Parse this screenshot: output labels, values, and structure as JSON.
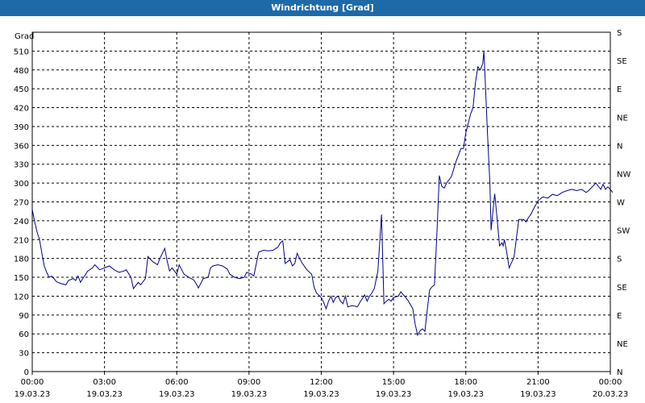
{
  "window": {
    "title": "Windrichtung [Grad]"
  },
  "chart_data": {
    "type": "line",
    "title": "Windrichtung [Grad]",
    "ylabel": "Grad",
    "xlabel": "",
    "ylim": [
      0,
      540
    ],
    "xlim_hours": [
      0,
      24
    ],
    "grid": true,
    "line_color": "#00008b",
    "y_ticks": [
      0,
      30,
      60,
      90,
      120,
      150,
      180,
      210,
      240,
      270,
      300,
      330,
      360,
      390,
      420,
      450,
      480,
      510
    ],
    "y_right_ticks": [
      {
        "value": 0,
        "label": "N"
      },
      {
        "value": 45,
        "label": "NE"
      },
      {
        "value": 90,
        "label": "E"
      },
      {
        "value": 135,
        "label": "SE"
      },
      {
        "value": 180,
        "label": "S"
      },
      {
        "value": 225,
        "label": "SW"
      },
      {
        "value": 270,
        "label": "W"
      },
      {
        "value": 315,
        "label": "NW"
      },
      {
        "value": 360,
        "label": "N"
      },
      {
        "value": 405,
        "label": "NE"
      },
      {
        "value": 450,
        "label": "E"
      },
      {
        "value": 495,
        "label": "SE"
      },
      {
        "value": 540,
        "label": "S"
      }
    ],
    "x_ticks": [
      {
        "hour": 0,
        "time": "00:00",
        "date": "19.03.23"
      },
      {
        "hour": 3,
        "time": "03:00",
        "date": "19.03.23"
      },
      {
        "hour": 6,
        "time": "06:00",
        "date": "19.03.23"
      },
      {
        "hour": 9,
        "time": "09:00",
        "date": "19.03.23"
      },
      {
        "hour": 12,
        "time": "12:00",
        "date": "19.03.23"
      },
      {
        "hour": 15,
        "time": "15:00",
        "date": "19.03.23"
      },
      {
        "hour": 18,
        "time": "18:00",
        "date": "19.03.23"
      },
      {
        "hour": 21,
        "time": "21:00",
        "date": "19.03.23"
      },
      {
        "hour": 24,
        "time": "00:00",
        "date": "20.03.23"
      }
    ],
    "series": [
      {
        "points": [
          [
            0.0,
            258
          ],
          [
            0.1,
            238
          ],
          [
            0.2,
            222
          ],
          [
            0.3,
            210
          ],
          [
            0.4,
            188
          ],
          [
            0.5,
            168
          ],
          [
            0.6,
            158
          ],
          [
            0.7,
            150
          ],
          [
            0.8,
            152
          ],
          [
            0.9,
            148
          ],
          [
            1.0,
            143
          ],
          [
            1.2,
            140
          ],
          [
            1.4,
            138
          ],
          [
            1.5,
            145
          ],
          [
            1.7,
            148
          ],
          [
            1.8,
            145
          ],
          [
            1.9,
            152
          ],
          [
            2.0,
            142
          ],
          [
            2.1,
            148
          ],
          [
            2.3,
            160
          ],
          [
            2.5,
            165
          ],
          [
            2.6,
            170
          ],
          [
            2.8,
            162
          ],
          [
            3.0,
            165
          ],
          [
            3.2,
            168
          ],
          [
            3.4,
            162
          ],
          [
            3.6,
            158
          ],
          [
            3.8,
            160
          ],
          [
            3.9,
            162
          ],
          [
            4.1,
            150
          ],
          [
            4.2,
            132
          ],
          [
            4.4,
            142
          ],
          [
            4.5,
            138
          ],
          [
            4.7,
            148
          ],
          [
            4.8,
            183
          ],
          [
            5.0,
            175
          ],
          [
            5.2,
            170
          ],
          [
            5.3,
            180
          ],
          [
            5.5,
            196
          ],
          [
            5.6,
            176
          ],
          [
            5.7,
            160
          ],
          [
            5.8,
            165
          ],
          [
            6.0,
            155
          ],
          [
            6.1,
            170
          ],
          [
            6.3,
            155
          ],
          [
            6.5,
            150
          ],
          [
            6.7,
            146
          ],
          [
            6.8,
            140
          ],
          [
            6.9,
            133
          ],
          [
            7.1,
            148
          ],
          [
            7.3,
            150
          ],
          [
            7.4,
            165
          ],
          [
            7.5,
            168
          ],
          [
            7.7,
            170
          ],
          [
            7.9,
            168
          ],
          [
            8.1,
            163
          ],
          [
            8.2,
            155
          ],
          [
            8.4,
            150
          ],
          [
            8.6,
            148
          ],
          [
            8.8,
            150
          ],
          [
            8.9,
            158
          ],
          [
            9.1,
            155
          ],
          [
            9.2,
            152
          ],
          [
            9.4,
            190
          ],
          [
            9.6,
            193
          ],
          [
            9.8,
            192
          ],
          [
            10.0,
            193
          ],
          [
            10.2,
            198
          ],
          [
            10.3,
            205
          ],
          [
            10.4,
            208
          ],
          [
            10.5,
            172
          ],
          [
            10.7,
            178
          ],
          [
            10.8,
            168
          ],
          [
            10.9,
            172
          ],
          [
            11.0,
            188
          ],
          [
            11.1,
            180
          ],
          [
            11.2,
            173
          ],
          [
            11.4,
            162
          ],
          [
            11.6,
            155
          ],
          [
            11.7,
            135
          ],
          [
            11.8,
            125
          ],
          [
            12.0,
            118
          ],
          [
            12.1,
            110
          ],
          [
            12.2,
            100
          ],
          [
            12.3,
            112
          ],
          [
            12.4,
            120
          ],
          [
            12.5,
            110
          ],
          [
            12.6,
            118
          ],
          [
            12.7,
            120
          ],
          [
            12.8,
            112
          ],
          [
            12.9,
            108
          ],
          [
            13.0,
            120
          ],
          [
            13.1,
            103
          ],
          [
            13.3,
            105
          ],
          [
            13.5,
            103
          ],
          [
            13.6,
            110
          ],
          [
            13.8,
            122
          ],
          [
            13.9,
            112
          ],
          [
            14.0,
            120
          ],
          [
            14.1,
            125
          ],
          [
            14.2,
            132
          ],
          [
            14.35,
            160
          ],
          [
            14.5,
            250
          ],
          [
            14.6,
            108
          ],
          [
            14.7,
            112
          ],
          [
            14.8,
            115
          ],
          [
            14.9,
            112
          ],
          [
            15.0,
            118
          ],
          [
            15.2,
            120
          ],
          [
            15.3,
            127
          ],
          [
            15.5,
            118
          ],
          [
            15.6,
            113
          ],
          [
            15.8,
            100
          ],
          [
            15.9,
            75
          ],
          [
            16.0,
            58
          ],
          [
            16.1,
            65
          ],
          [
            16.2,
            68
          ],
          [
            16.3,
            64
          ],
          [
            16.4,
            98
          ],
          [
            16.5,
            130
          ],
          [
            16.6,
            135
          ],
          [
            16.7,
            138
          ],
          [
            16.8,
            220
          ],
          [
            16.9,
            312
          ],
          [
            17.0,
            295
          ],
          [
            17.1,
            292
          ],
          [
            17.2,
            300
          ],
          [
            17.4,
            310
          ],
          [
            17.6,
            335
          ],
          [
            17.8,
            355
          ],
          [
            17.9,
            355
          ],
          [
            18.0,
            380
          ],
          [
            18.2,
            410
          ],
          [
            18.3,
            420
          ],
          [
            18.4,
            460
          ],
          [
            18.5,
            485
          ],
          [
            18.6,
            480
          ],
          [
            18.7,
            490
          ],
          [
            18.75,
            510
          ],
          [
            18.8,
            470
          ],
          [
            18.9,
            380
          ],
          [
            19.0,
            300
          ],
          [
            19.05,
            225
          ],
          [
            19.1,
            245
          ],
          [
            19.2,
            283
          ],
          [
            19.3,
            243
          ],
          [
            19.4,
            200
          ],
          [
            19.5,
            205
          ],
          [
            19.55,
            200
          ],
          [
            19.6,
            210
          ],
          [
            19.7,
            190
          ],
          [
            19.8,
            165
          ],
          [
            20.0,
            182
          ],
          [
            20.2,
            242
          ],
          [
            20.4,
            242
          ],
          [
            20.5,
            238
          ],
          [
            20.6,
            245
          ],
          [
            20.7,
            250
          ],
          [
            20.8,
            258
          ],
          [
            21.0,
            272
          ],
          [
            21.2,
            278
          ],
          [
            21.4,
            276
          ],
          [
            21.6,
            282
          ],
          [
            21.8,
            280
          ],
          [
            22.0,
            285
          ],
          [
            22.2,
            288
          ],
          [
            22.4,
            290
          ],
          [
            22.6,
            288
          ],
          [
            22.8,
            290
          ],
          [
            23.0,
            285
          ],
          [
            23.1,
            288
          ],
          [
            23.2,
            292
          ],
          [
            23.4,
            300
          ],
          [
            23.5,
            295
          ],
          [
            23.6,
            290
          ],
          [
            23.7,
            298
          ],
          [
            23.8,
            290
          ],
          [
            23.9,
            294
          ],
          [
            24.0,
            290
          ],
          [
            24.1,
            285
          ]
        ]
      }
    ]
  }
}
